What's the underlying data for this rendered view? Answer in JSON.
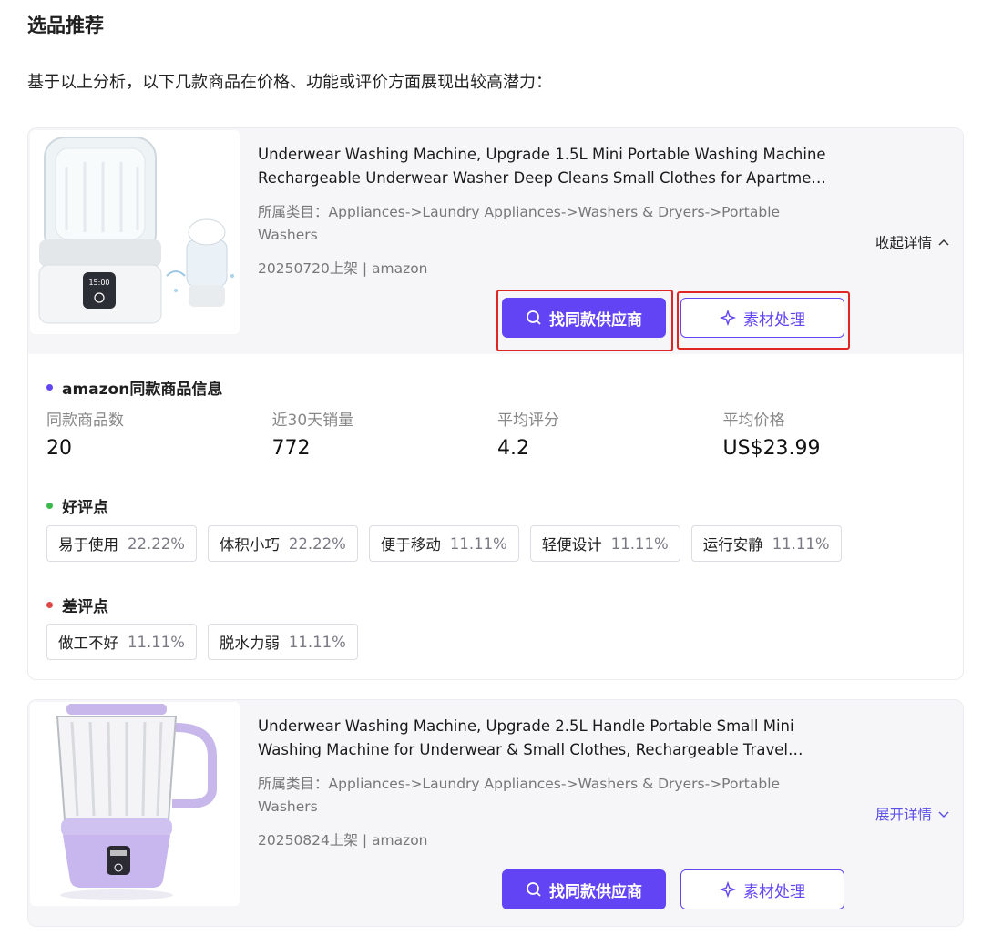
{
  "section_title": "选品推荐",
  "intro": "基于以上分析，以下几款商品在价格、功能或评价方面展现出较高潜力：",
  "colors": {
    "accent": "#6344f5",
    "positive_dot": "#3db84a",
    "negative_dot": "#e04848",
    "info_dot": "#6344f5",
    "highlight": "#e02525"
  },
  "products": [
    {
      "title": "Underwear Washing Machine, Upgrade 1.5L Mini Portable Washing Machine Rechargeable Underwear Washer Deep Cleans Small Clothes for Apartme…",
      "category": "所属类目：Appliances->Laundry Appliances->Washers & Dryers->Portable Washers",
      "meta": "20250720上架 | amazon",
      "toggle": "收起详情",
      "find_supplier": "找同款供应商",
      "material": "素材处理",
      "stats_title": "amazon同款商品信息",
      "stats": [
        {
          "label": "同款商品数",
          "value": "20"
        },
        {
          "label": "近30天销量",
          "value": "772"
        },
        {
          "label": "平均评分",
          "value": "4.2"
        },
        {
          "label": "平均价格",
          "value": "US$23.99"
        }
      ],
      "positive_title": "好评点",
      "positive": [
        {
          "name": "易于使用",
          "pct": "22.22%"
        },
        {
          "name": "体积小巧",
          "pct": "22.22%"
        },
        {
          "name": "便于移动",
          "pct": "11.11%"
        },
        {
          "name": "轻便设计",
          "pct": "11.11%"
        },
        {
          "name": "运行安静",
          "pct": "11.11%"
        }
      ],
      "negative_title": "差评点",
      "negative": [
        {
          "name": "做工不好",
          "pct": "11.11%"
        },
        {
          "name": "脱水力弱",
          "pct": "11.11%"
        }
      ]
    },
    {
      "title": "Underwear Washing Machine, Upgrade 2.5L Handle Portable Small Mini Washing Machine for Underwear & Small Clothes, Rechargeable Travel Laundr…",
      "category": "所属类目：Appliances->Laundry Appliances->Washers & Dryers->Portable Washers",
      "meta": "20250824上架 | amazon",
      "toggle": "展开详情",
      "find_supplier": "找同款供应商",
      "material": "素材处理"
    }
  ]
}
